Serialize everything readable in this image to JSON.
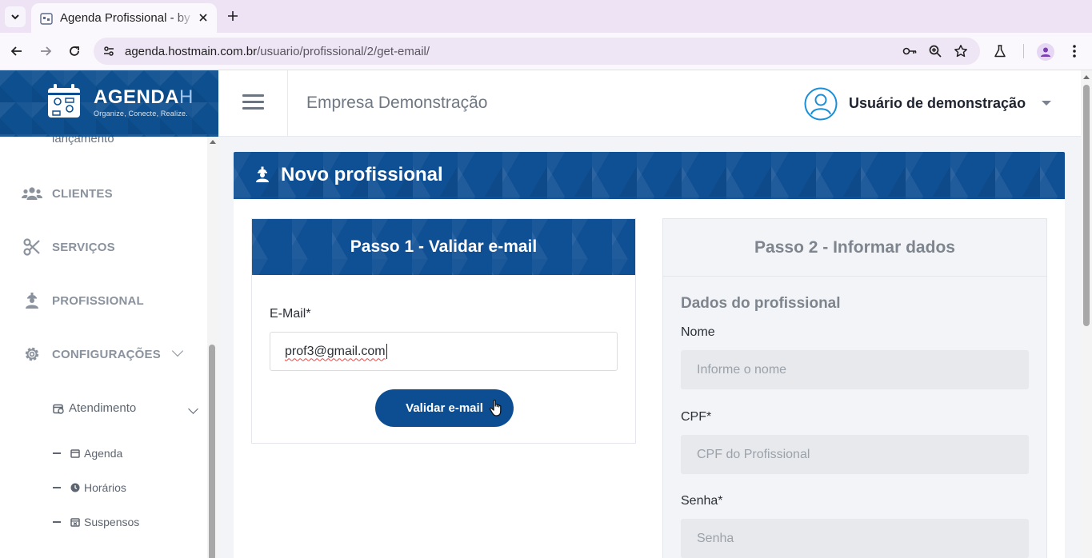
{
  "browser": {
    "tab_title": "Agenda Profissional - by Hostmain",
    "url_host": "agenda.hostmain.com.br",
    "url_path": "/usuario/profissional/2/get-email/"
  },
  "brand": {
    "name": "AGENDA",
    "name_suffix": "H",
    "tagline": "Organize, Conecte, Realize."
  },
  "header": {
    "company": "Empresa Demonstração",
    "user_name": "Usuário de demonstração"
  },
  "sidebar": {
    "cut_item": "lançamento",
    "items": [
      {
        "label": "CLIENTES",
        "icon": "users-icon"
      },
      {
        "label": "SERVIÇOS",
        "icon": "scissors-icon"
      },
      {
        "label": "PROFISSIONAL",
        "icon": "worker-icon"
      },
      {
        "label": "CONFIGURAÇÕES",
        "icon": "gear-icon"
      }
    ],
    "sub_item": {
      "label": "Atendimento",
      "icon": "calendar-clock-icon"
    },
    "sub_sub_items": [
      {
        "label": "Agenda",
        "icon": "calendar-icon"
      },
      {
        "label": "Horários",
        "icon": "clock-icon"
      },
      {
        "label": "Suspensos",
        "icon": "calendar-x-icon"
      }
    ]
  },
  "main": {
    "title": "Novo profissional",
    "step1": {
      "title": "Passo 1 - Validar e-mail",
      "email_label": "E-Mail*",
      "email_value": "prof3@gmail.com",
      "button": "Validar e-mail"
    },
    "step2": {
      "title": "Passo 2 - Informar dados",
      "section": "Dados do profissional",
      "fields": [
        {
          "label": "Nome",
          "placeholder": "Informe o nome"
        },
        {
          "label": "CPF*",
          "placeholder": "CPF do Profissional"
        },
        {
          "label": "Senha*",
          "placeholder": "Senha"
        }
      ]
    }
  },
  "colors": {
    "brand_blue": "#0d4f8f",
    "content_bg": "#f2f4f7"
  }
}
